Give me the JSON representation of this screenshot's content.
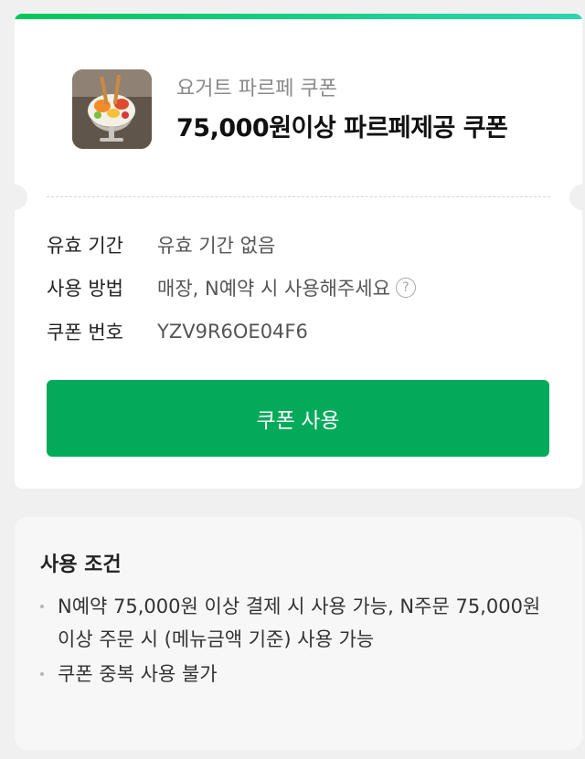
{
  "coupon": {
    "category": "요거트 파르페 쿠폰",
    "title": "75,000원이상 파르페제공 쿠폰",
    "thumbnail_alt": "파르페 이미지",
    "details": [
      {
        "label": "유효 기간",
        "value": "유효 기간 없음"
      },
      {
        "label": "사용 방법",
        "value": "매장, N예약 시 사용해주세요"
      },
      {
        "label": "쿠폰 번호",
        "value": "YZV9R6OE04F6"
      }
    ],
    "help_icon": "?",
    "use_button_label": "쿠폰 사용"
  },
  "terms": {
    "title": "사용 조건",
    "items": [
      "N예약 75,000원 이상 결제 시 사용 가능, N주문 75,000원 이상 주문 시 (메뉴금액 기준) 사용 가능",
      "쿠폰 중복 사용 불가"
    ]
  },
  "colors": {
    "accent_green": "#03aa5a",
    "top_bar_start": "#03c75a",
    "top_bar_end": "#2ad6b0"
  }
}
